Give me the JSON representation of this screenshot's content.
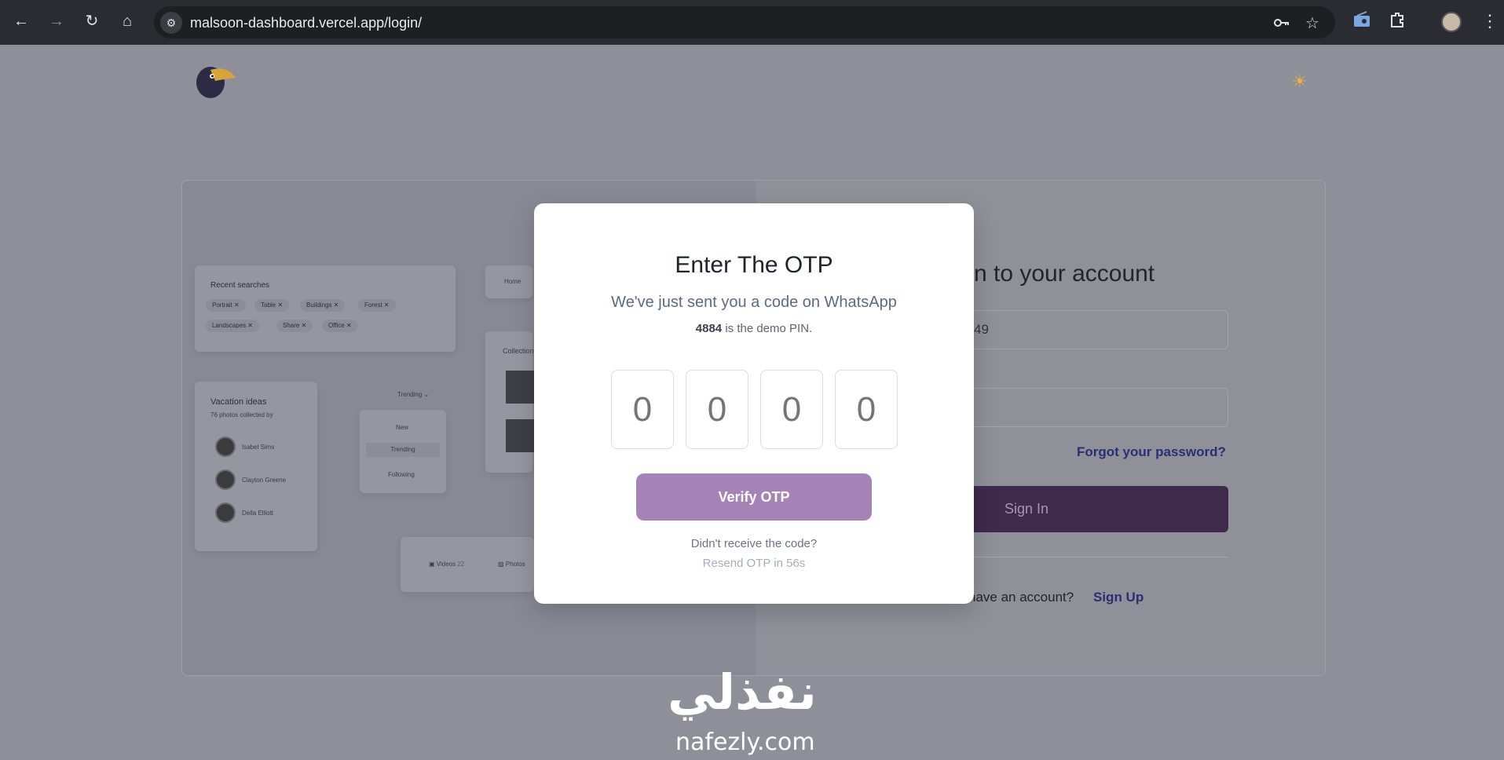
{
  "browser": {
    "url": "malsoon-dashboard.vercel.app/login/",
    "nav": {
      "back": "←",
      "forward": "→",
      "reload": "↻",
      "home": "⌂"
    },
    "icons": [
      "key-icon",
      "star-icon",
      "radio-extension-icon",
      "puzzle-extensions-icon",
      "profile-avatar",
      "more-menu-icon"
    ]
  },
  "page": {
    "theme_toggle_icon": "sun-icon",
    "login": {
      "title": "Sign in to your account",
      "title_visible": "n to your account",
      "phone_partial": "49",
      "forgot": "Forgot your password?",
      "sign_in": "Sign In",
      "no_account": "have an account?",
      "sign_up": "Sign Up"
    },
    "mockup": {
      "recent_searches": "Recent searches",
      "chips": [
        "Portrait",
        "Table",
        "Buildings",
        "Forest",
        "Landscapes",
        "Share",
        "Office"
      ],
      "home": "Home",
      "collection": "Collection",
      "vacation_title": "Vacation ideas",
      "vacation_sub": "76 photos collected by",
      "people": [
        "Isabel Sims",
        "Clayton Greene",
        "Della Elliott"
      ],
      "trending_select": "Trending",
      "menu": [
        "New",
        "Trending",
        "Following"
      ],
      "tabs": [
        "Videos",
        "Photos"
      ],
      "videos_count": "22"
    }
  },
  "modal": {
    "title": "Enter The OTP",
    "subtitle": "We've just sent you a code on WhatsApp",
    "pin": "4884",
    "pin_suffix": " is the demo PIN.",
    "otp_placeholders": [
      "0",
      "0",
      "0",
      "0"
    ],
    "verify": "Verify OTP",
    "didnt_receive": "Didn't receive the code?",
    "resend": "Resend OTP in 56s"
  },
  "watermark": {
    "arabic": "نفذلي",
    "latin": "nafezly.com"
  },
  "colors": {
    "accent": "#a683b6",
    "link": "#2a2f74",
    "sign_in_bg": "#3f2a4b"
  }
}
